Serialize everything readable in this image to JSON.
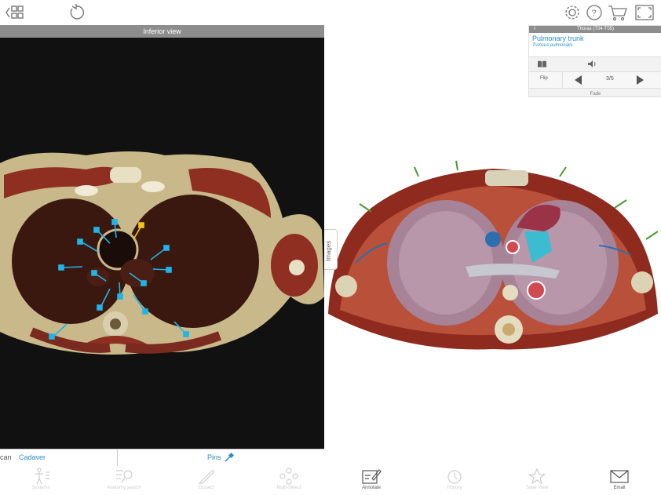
{
  "toolbar_top": {
    "icons": [
      "grid-back-icon",
      "reset-icon",
      "settings-icon",
      "help-icon",
      "cart-icon",
      "fullscreen-icon"
    ]
  },
  "left_panel": {
    "title": "Inferior view",
    "image": "axial cadaver section thorax with pins",
    "bottom": {
      "scan_label": "can",
      "cadaver_label": "Cadaver",
      "pins_label": "Pins"
    }
  },
  "images_tab": {
    "label": "Images"
  },
  "info_card": {
    "header": "Thorax (T04-T05)",
    "structure_name": "Pulmonary trunk",
    "latin_name": "Truncus pulmonalis",
    "flip_label": "Flip",
    "page": "3/5",
    "fade_label": "Fade"
  },
  "bottom_toolbar": {
    "items": [
      {
        "label": "Systems",
        "icon": "body-icon"
      },
      {
        "label": "Anatomy search",
        "icon": "search-list-icon"
      },
      {
        "label": "Dissect",
        "icon": "scalpel-icon"
      },
      {
        "label": "Multi-Select",
        "icon": "multi-select-icon"
      },
      {
        "label": "Annotate",
        "icon": "annotate-icon"
      },
      {
        "label": "History",
        "icon": "history-icon"
      },
      {
        "label": "Save View",
        "icon": "star-icon"
      },
      {
        "label": "Email",
        "icon": "email-icon"
      }
    ]
  },
  "colors": {
    "accent": "#2a8fc4",
    "pin": "#1fb5e6",
    "pin_selected": "#f2c418"
  }
}
